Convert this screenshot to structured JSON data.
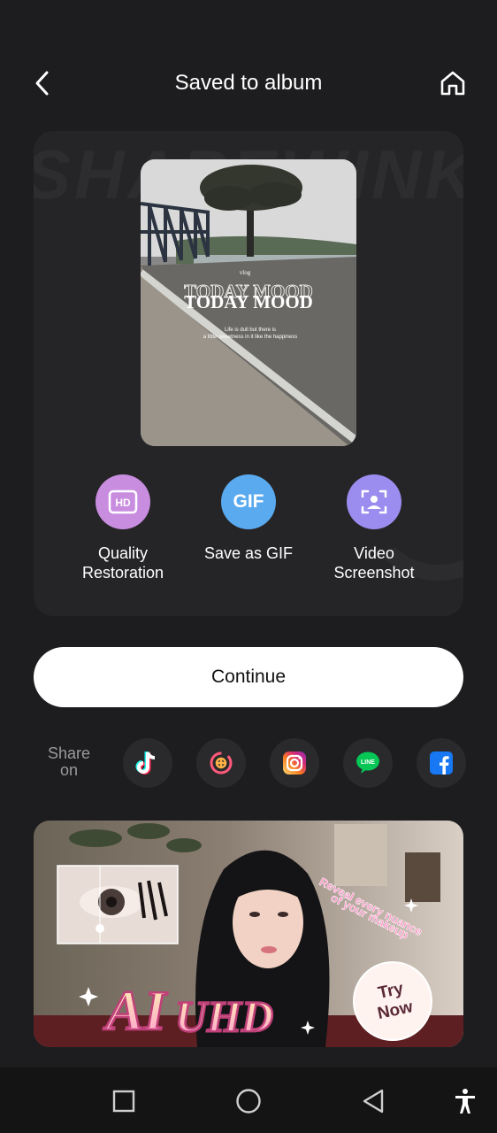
{
  "header": {
    "title": "Saved to album",
    "back_icon": "chevron-left-icon",
    "home_icon": "home-icon"
  },
  "preview": {
    "watermark": "SHAPEWINK",
    "overlay_small": "vlog",
    "overlay_title_1": "TODAY MOOD",
    "overlay_title_2": "TODAY MOOD",
    "overlay_caption_1": "Life is dull but there is",
    "overlay_caption_2": "a little sweetness in it like the happiness"
  },
  "actions": [
    {
      "label_1": "Quality",
      "label_2": "Restoration",
      "icon": "hd-icon",
      "badge": "HD",
      "color": "#c98de0"
    },
    {
      "label_1": "Save as GIF",
      "label_2": "",
      "icon": "gif-icon",
      "badge": "GIF",
      "color": "#5aaaf0"
    },
    {
      "label_1": "Video",
      "label_2": "Screenshot",
      "icon": "screenshot-icon",
      "badge": "",
      "color": "#9b8cef"
    }
  ],
  "continue_label": "Continue",
  "share": {
    "label_1": "Share",
    "label_2": "on",
    "targets": [
      "tiktok-icon",
      "instagram-reels-icon",
      "instagram-icon",
      "line-icon",
      "facebook-icon"
    ],
    "line_text": "LINE"
  },
  "banner": {
    "tagline_1": "Reveal every nuance",
    "tagline_2": "of your makeup",
    "big_text_1": "AI",
    "big_text_2": "UHD",
    "cta_1": "Try",
    "cta_2": "Now"
  },
  "navbar": [
    "square-icon",
    "circle-icon",
    "triangle-back-icon",
    "accessibility-icon"
  ],
  "colors": {
    "background": "#1d1d1f",
    "card": "#252527",
    "continue_bg": "#ffffff",
    "share_label": "#9a9a9e"
  }
}
